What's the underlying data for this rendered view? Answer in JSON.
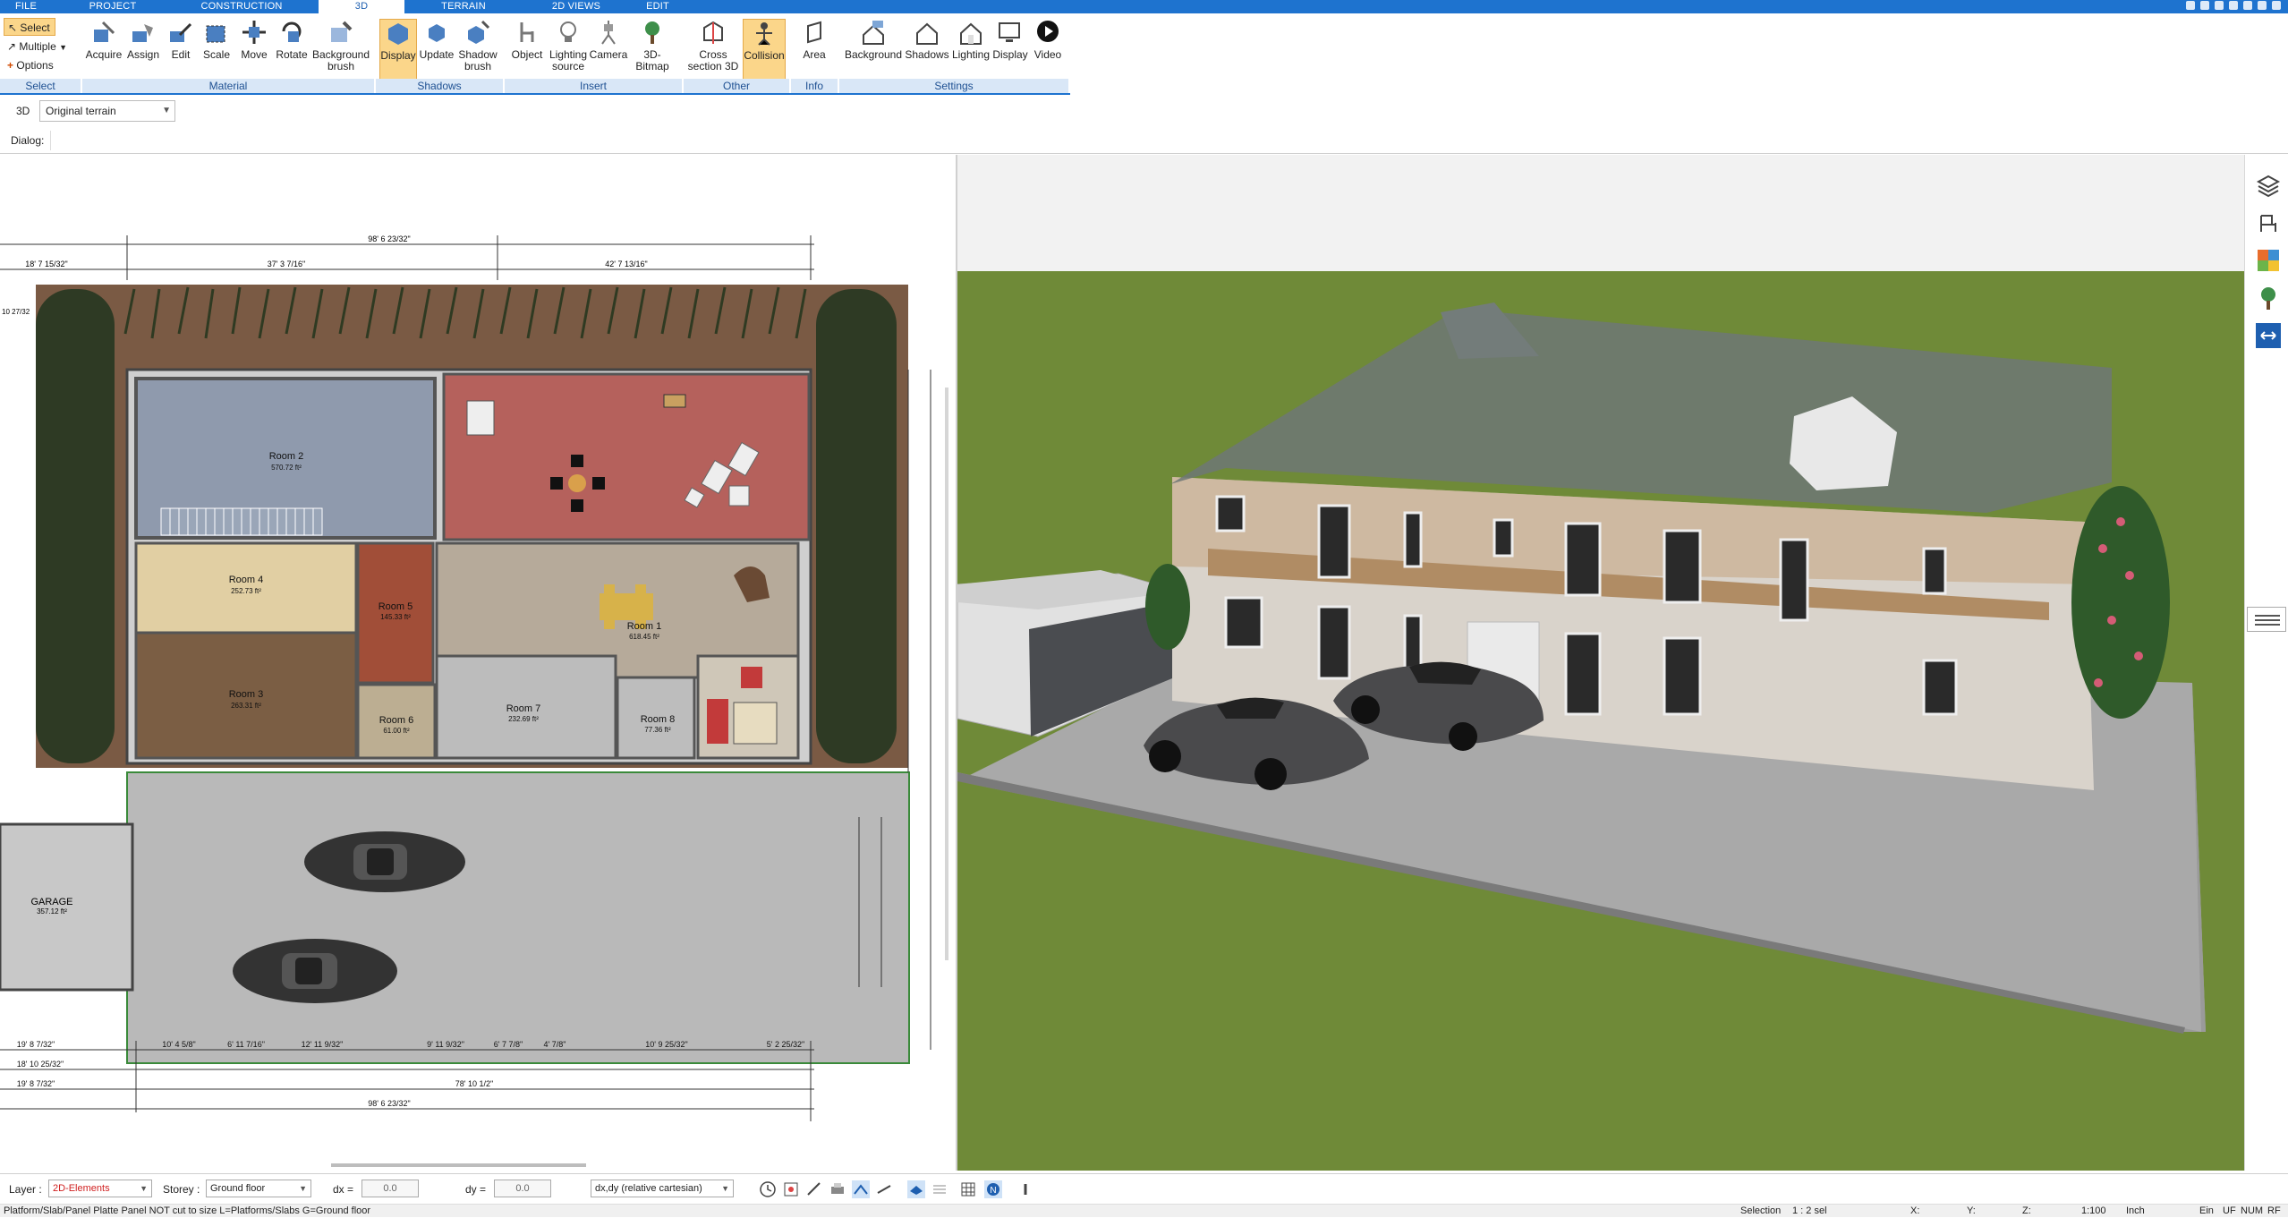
{
  "menu": {
    "tabs": [
      {
        "label": "FILE"
      },
      {
        "label": "PROJECT"
      },
      {
        "label": "CONSTRUCTION"
      },
      {
        "label": "3D",
        "active": true
      },
      {
        "label": "TERRAIN"
      },
      {
        "label": "2D VIEWS"
      },
      {
        "label": "EDIT"
      }
    ]
  },
  "ribbon": {
    "select_group": {
      "select": "Select",
      "multiple": "Multiple",
      "options": "Options",
      "group_label": "Select"
    },
    "material_group": {
      "label": "Material",
      "buttons": [
        "Acquire",
        "Assign",
        "Edit",
        "Scale",
        "Move",
        "Rotate",
        "Background brush"
      ]
    },
    "shadows_group": {
      "label": "Shadows",
      "buttons": [
        "Display",
        "Update",
        "Shadow brush"
      ]
    },
    "insert_group": {
      "label": "Insert",
      "buttons": [
        "Object",
        "Lighting source",
        "Camera",
        "3D-Bitmap"
      ]
    },
    "other_group": {
      "label": "Other",
      "buttons": [
        "Cross section 3D",
        "Collision"
      ]
    },
    "info_group": {
      "label": "Info",
      "buttons": [
        "Area"
      ]
    },
    "settings_group": {
      "label": "Settings",
      "buttons": [
        "Background",
        "Shadows",
        "Lighting",
        "Display",
        "Video"
      ]
    }
  },
  "toolbar3d": {
    "mode_label": "3D",
    "terrain_value": "Original terrain"
  },
  "dialog": {
    "label": "Dialog:"
  },
  "plan": {
    "rooms": [
      {
        "name": "Room 2",
        "area": "570.72 ft²"
      },
      {
        "name": "Room 4",
        "area": "252.73 ft²"
      },
      {
        "name": "Room 3",
        "area": "263.31 ft²"
      },
      {
        "name": "Room 5",
        "area": "145.33 ft²"
      },
      {
        "name": "Room 1",
        "area": "618.45 ft²"
      },
      {
        "name": "Room 6",
        "area": "61.00 ft²"
      },
      {
        "name": "Room 7",
        "area": "232.69 ft²"
      },
      {
        "name": "Room 8",
        "area": "77.36 ft²"
      },
      {
        "name": "GARAGE",
        "area": "357.12 ft²"
      }
    ],
    "dims": {
      "top_total": "98' 6 23/32\"",
      "top_left": "18' 7 15/32\"",
      "top_mid": "37' 3 7/16\"",
      "top_right": "42' 7 13/16\"",
      "bottom_a": "19' 8 7/32\"",
      "bottom_b": "18' 10 25/32\"",
      "bottom_c": "19' 8 7/32\"",
      "bottom_d": "78' 10 1/2\"",
      "bottom_total": "98' 6 23/32\"",
      "seg1": "10' 4 5/8\"",
      "seg2": "6' 11 7/16\"",
      "seg3": "12' 11 9/32\"",
      "seg4": "9' 11 9/32\"",
      "seg5": "6' 7 7/8\"",
      "seg6": "4' 7/8\"",
      "seg7": "10' 9 25/32\"",
      "seg8": "5' 2 25/32\"",
      "left_mark": "10 27/32"
    }
  },
  "bottom": {
    "layer_label": "Layer :",
    "layer_value": "2D-Elements",
    "storey_label": "Storey :",
    "storey_value": "Ground floor",
    "dx_label": "dx =",
    "dx_value": "0.0",
    "dy_label": "dy =",
    "dy_value": "0.0",
    "coord_mode": "dx,dy (relative cartesian)"
  },
  "status": {
    "message": "Platform/Slab/Panel Platte Panel NOT cut to size L=Platforms/Slabs G=Ground floor",
    "selection_label": "Selection",
    "selection_value": "1 : 2 sel",
    "x_label": "X:",
    "y_label": "Y:",
    "z_label": "Z:",
    "scale": "1:100",
    "unit": "Inch",
    "ein": "Ein",
    "uf": "UF",
    "num": "NUM",
    "rf": "RF"
  },
  "colors": {
    "accent": "#1e73cf",
    "ribbon_group_bar": "#d9e7f7",
    "active_button": "#fbd68a",
    "grass": "#6f8a38",
    "driveway": "#a9a9a9"
  }
}
